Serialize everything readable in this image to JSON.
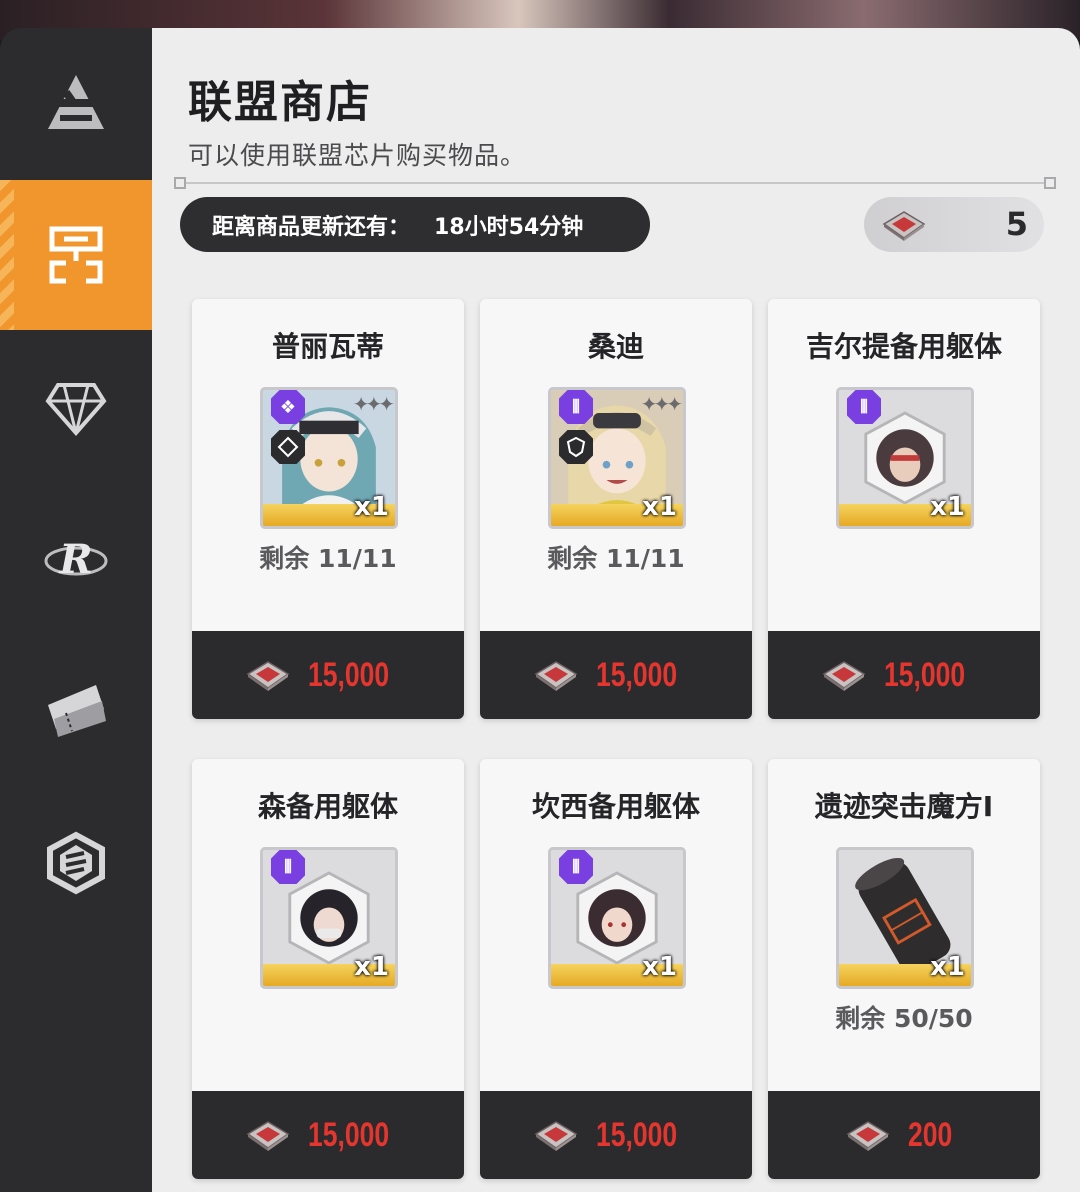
{
  "shop": {
    "title": "联盟商店",
    "subtitle": "可以使用联盟芯片购买物品。",
    "refresh_label": "距离商品更新还有：",
    "refresh_time": "18小时54分钟",
    "currency_count": "5",
    "currency_icon": "alliance-chip-icon"
  },
  "sidebar": {
    "items": [
      {
        "icon": "anvil-icon",
        "active": false
      },
      {
        "icon": "shop-icon",
        "active": true
      },
      {
        "icon": "diamond-icon",
        "active": false
      },
      {
        "icon": "r-logo-icon",
        "active": false
      },
      {
        "icon": "ticket-icon",
        "active": false
      },
      {
        "icon": "hexagon-badge-icon",
        "active": false
      }
    ]
  },
  "items": [
    {
      "name": "普丽瓦蒂",
      "qty": "x1",
      "remain": "剩余 11/11",
      "price": "15,000",
      "type": "character"
    },
    {
      "name": "桑迪",
      "qty": "x1",
      "remain": "剩余 11/11",
      "price": "15,000",
      "type": "character"
    },
    {
      "name": "吉尔提备用躯体",
      "qty": "x1",
      "remain": "",
      "price": "15,000",
      "type": "body"
    },
    {
      "name": "森备用躯体",
      "qty": "x1",
      "remain": "",
      "price": "15,000",
      "type": "body"
    },
    {
      "name": "坎西备用躯体",
      "qty": "x1",
      "remain": "",
      "price": "15,000",
      "type": "body"
    },
    {
      "name": "遗迹突击魔方I",
      "qty": "x1",
      "remain": "剩余 50/50",
      "price": "200",
      "type": "cube"
    }
  ],
  "colors": {
    "accent": "#f0962d",
    "price": "#e5352f",
    "rarity": "#7a3fe0"
  }
}
